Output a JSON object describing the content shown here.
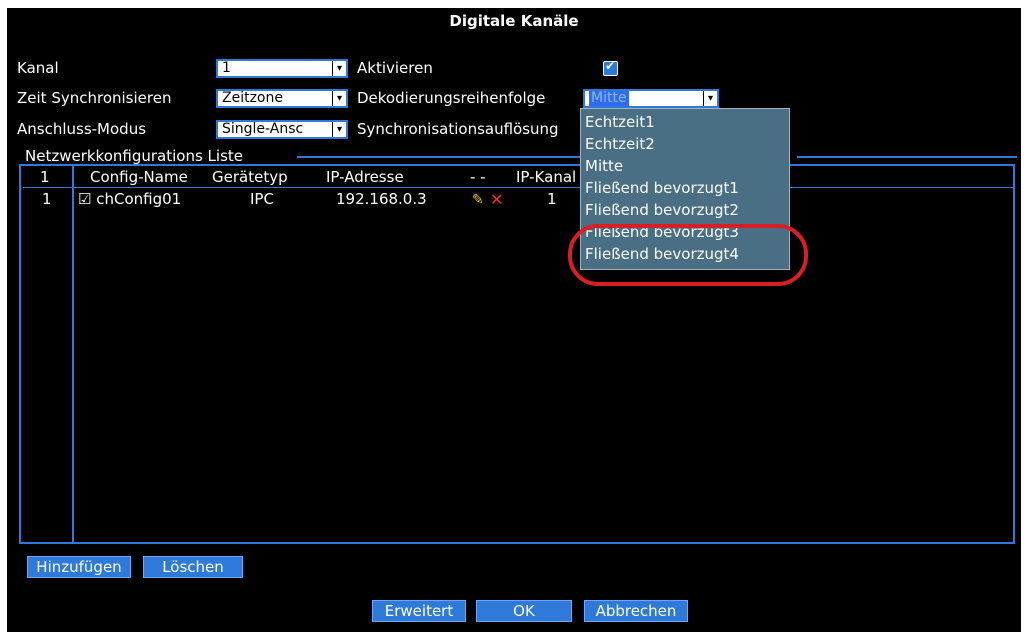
{
  "window": {
    "title": "Digitale Kanäle"
  },
  "form": {
    "kanal_label": "Kanal",
    "kanal_value": "1",
    "aktivieren_label": "Aktivieren",
    "zeit_label": "Zeit Synchronisieren",
    "zeit_value": "Zeitzone",
    "dekod_label": "Dekodierungsreihenfolge",
    "dekod_value": "Mitte",
    "anschluss_label": "Anschluss-Modus",
    "anschluss_value": "Single-Ansc",
    "sync_label": "Synchronisationsauflösung"
  },
  "list": {
    "group_label": "Netzwerkkonfigurations Liste",
    "headers": {
      "index": "1",
      "config_name": "Config-Name",
      "device_type": "Gerätetyp",
      "ip": "IP-Adresse",
      "dash": "- -",
      "ip_channel": "IP-Kanal"
    },
    "rows": [
      {
        "index": "1",
        "config_name": "chConfig01",
        "device_type": "IPC",
        "ip": "192.168.0.3",
        "ip_channel": "1"
      }
    ]
  },
  "dropdown": {
    "options": [
      "Echtzeit1",
      "Echtzeit2",
      "Mitte",
      "Fließend bevorzugt1",
      "Fließend bevorzugt2",
      "Fließend bevorzugt3",
      "Fließend bevorzugt4"
    ]
  },
  "buttons": {
    "add": "Hinzufügen",
    "delete": "Löschen",
    "advanced": "Erweitert",
    "ok": "OK",
    "cancel": "Abbrechen"
  },
  "colors": {
    "accent": "#2f7ad8",
    "dropdown_bg": "#4a6e84",
    "annotation": "#d81f26"
  },
  "icons": {
    "edit": "pencil-icon",
    "delete": "delete-x-icon",
    "checkbox": "checkbox-icon"
  }
}
